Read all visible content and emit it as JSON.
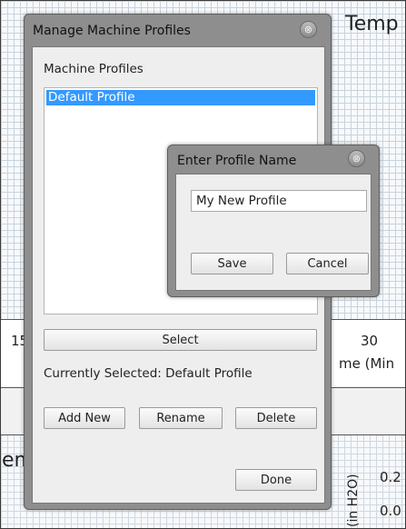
{
  "background": {
    "title_fragment": "Temp",
    "tick_left": "15",
    "tick_right": "30",
    "xlabel_fragment": "me (Min",
    "ylabel_fragment": "(in H2O)",
    "value_1": "0.2",
    "value_2": "0.0",
    "left_fragment": "em"
  },
  "manage_dialog": {
    "title": "Manage Machine Profiles",
    "close_glyph": "⊗",
    "profiles_label": "Machine Profiles",
    "profiles": [
      "Default Profile"
    ],
    "selected_index": 0,
    "select_label": "Select",
    "currently_selected": "Currently Selected: Default Profile",
    "add_new_label": "Add New",
    "rename_label": "Rename",
    "delete_label": "Delete",
    "done_label": "Done"
  },
  "profile_name_dialog": {
    "title": "Enter Profile Name",
    "close_glyph": "⊗",
    "input_value": "My New Profile",
    "save_label": "Save",
    "cancel_label": "Cancel"
  }
}
